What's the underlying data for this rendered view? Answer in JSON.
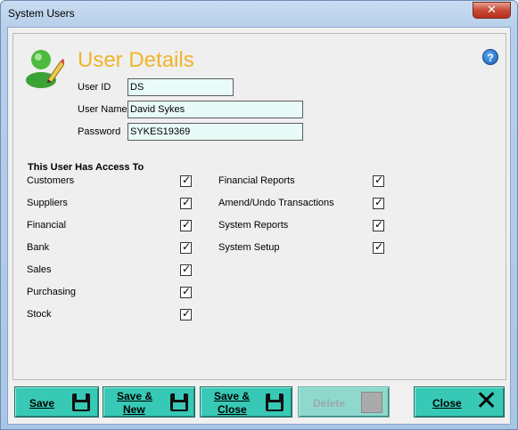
{
  "window": {
    "title": "System Users",
    "close_glyph": "✕"
  },
  "header": {
    "title": "User Details",
    "help_glyph": "?"
  },
  "fields": {
    "user_id": {
      "label": "User ID",
      "value": "DS"
    },
    "user_name": {
      "label": "User Name",
      "value": "David Sykes"
    },
    "password": {
      "label": "Password",
      "value": "SYKES19369"
    }
  },
  "access": {
    "title": "This User Has Access To",
    "left": [
      {
        "label": "Customers",
        "checked": true
      },
      {
        "label": "Suppliers",
        "checked": true
      },
      {
        "label": "Financial",
        "checked": true
      },
      {
        "label": "Bank",
        "checked": true
      },
      {
        "label": "Sales",
        "checked": true
      },
      {
        "label": "Purchasing",
        "checked": true
      },
      {
        "label": "Stock",
        "checked": true
      }
    ],
    "right": [
      {
        "label": "Financial Reports",
        "checked": true
      },
      {
        "label": "Amend/Undo Transactions",
        "checked": true
      },
      {
        "label": "System Reports",
        "checked": true
      },
      {
        "label": "System Setup",
        "checked": true
      }
    ]
  },
  "buttons": {
    "save": {
      "label": "Save",
      "icon": "floppy-disk-icon"
    },
    "save_new_1": {
      "label": "Save &"
    },
    "save_new_2": {
      "label": "New"
    },
    "save_close_1": {
      "label": "Save &"
    },
    "save_close_2": {
      "label": "Close"
    },
    "delete": {
      "label": "Delete",
      "enabled": false
    },
    "close": {
      "label": "Close",
      "glyph": "✕"
    }
  },
  "colors": {
    "button": "#37c9b5",
    "heading": "#f0b429",
    "field_bg": "#e8fbf8"
  }
}
